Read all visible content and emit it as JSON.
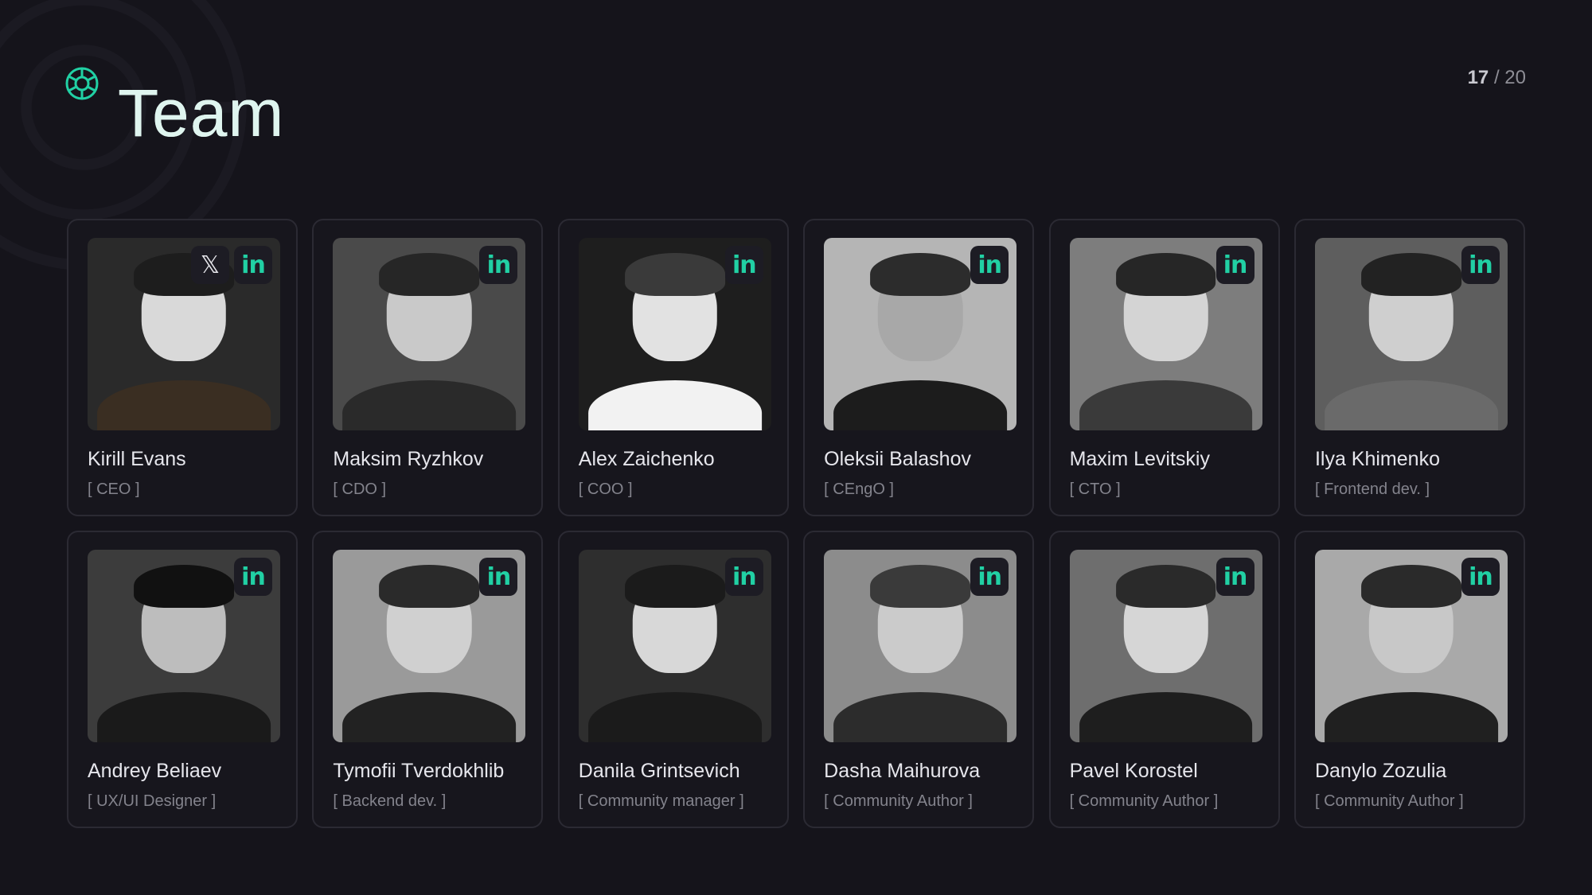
{
  "header": {
    "title": "Team",
    "logo_icon": "aperture-logo-icon",
    "accent_color": "#21d0a4"
  },
  "pager": {
    "current": "17",
    "separator": "/",
    "total": "20"
  },
  "social_labels": {
    "linkedin": "in",
    "x": "𝕏"
  },
  "members": [
    {
      "name": "Kirill Evans",
      "role": "[ CEO ]",
      "has_x": true
    },
    {
      "name": "Maksim Ryzhkov",
      "role": "[ CDO ]",
      "has_x": false
    },
    {
      "name": "Alex Zaichenko",
      "role": "[ COO ]",
      "has_x": false
    },
    {
      "name": "Oleksii Balashov",
      "role": "[ CEngO ]",
      "has_x": false
    },
    {
      "name": "Maxim Levitskiy",
      "role": "[ CTO ]",
      "has_x": false
    },
    {
      "name": "Ilya Khimenko",
      "role": "[ Frontend dev. ]",
      "has_x": false
    },
    {
      "name": "Andrey Beliaev",
      "role": "[ UX/UI Designer ]",
      "has_x": false
    },
    {
      "name": "Tymofii Tverdokhlib",
      "role": "[ Backend dev. ]",
      "has_x": false
    },
    {
      "name": "Danila Grintsevich",
      "role": "[ Community manager ]",
      "has_x": false
    },
    {
      "name": "Dasha Maihurova",
      "role": "[ Community Author ]",
      "has_x": false
    },
    {
      "name": "Pavel Korostel",
      "role": "[ Community Author ]",
      "has_x": false
    },
    {
      "name": "Danylo Zozulia",
      "role": "[ Community Author ]",
      "has_x": false
    }
  ]
}
